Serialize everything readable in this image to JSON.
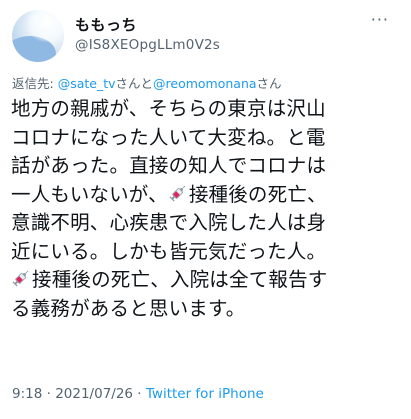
{
  "tweet": {
    "display_name": "ももっち",
    "handle": "@IS8XEOpgLLm0V2s",
    "more_label": "···",
    "reply": {
      "prefix": "返信先: ",
      "mention1": "@sate_tv",
      "joiner": "さんと",
      "mention2": "@reomomonana",
      "suffix": "さん"
    },
    "body_lines": [
      "地方の親戚が、そちらの東京は沢山",
      "コロナになった人いて大変ね。と電",
      "話があった。直接の知人でコロナは",
      "接種後の死亡、",
      "意識不明、心疾患で入院した人は身",
      "近にいる。しかも皆元気だった人。",
      "接種後の死亡、入院は全て報告す",
      "る義務があると思います。"
    ],
    "line4_prefix": "一人もいないが、",
    "time": "9:18",
    "sep": " · ",
    "date": "2021/07/26",
    "sep2": " · ",
    "source": "Twitter for iPhone"
  },
  "icons": [
    "syringe-icon",
    "more-icon",
    "avatar"
  ],
  "colors": {
    "link": "#1d9bf0",
    "secondary": "#536471",
    "text": "#0f1419"
  }
}
